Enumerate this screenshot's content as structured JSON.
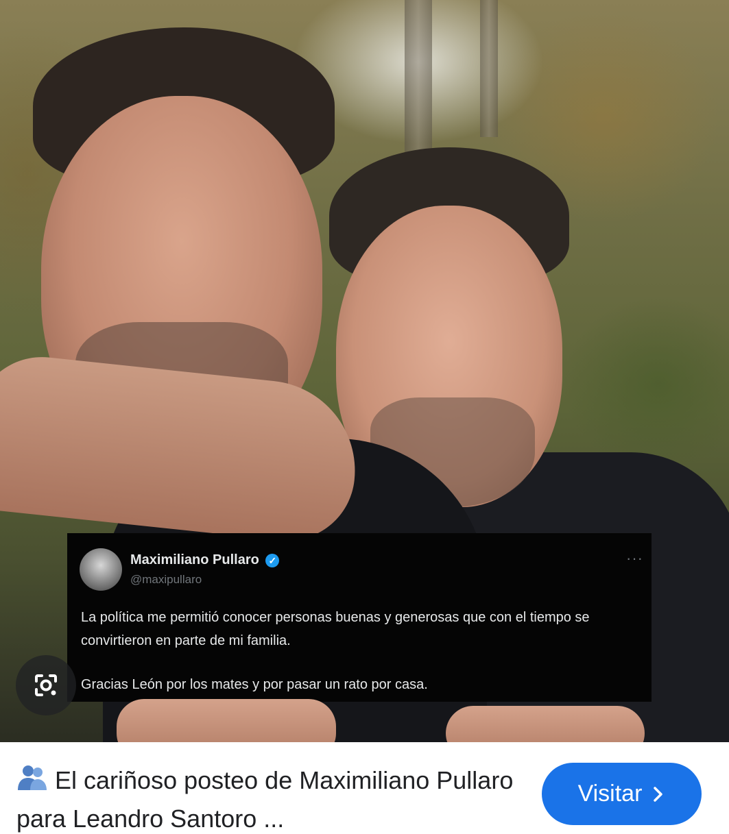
{
  "image": {
    "tweet": {
      "author_name": "Maximiliano Pullaro",
      "handle": "@maxipullaro",
      "text_line1": "La política me permitió conocer personas buenas y generosas que con el tiempo se convirtieron en parte de mi familia.",
      "text_line2": "Gracias León por los mates y por pasar un rato por casa.",
      "verified_icon": "verified-badge-icon",
      "more_icon": "more-horizontal-icon"
    },
    "lens_icon": "google-lens-icon"
  },
  "result": {
    "title": "El cariñoso posteo de Maximiliano Pullaro para Leandro Santoro ...",
    "title_icon": "people-hugging-icon",
    "visit_label": "Visitar",
    "visit_icon": "chevron-right-icon",
    "accent_color": "#1a73e8"
  }
}
